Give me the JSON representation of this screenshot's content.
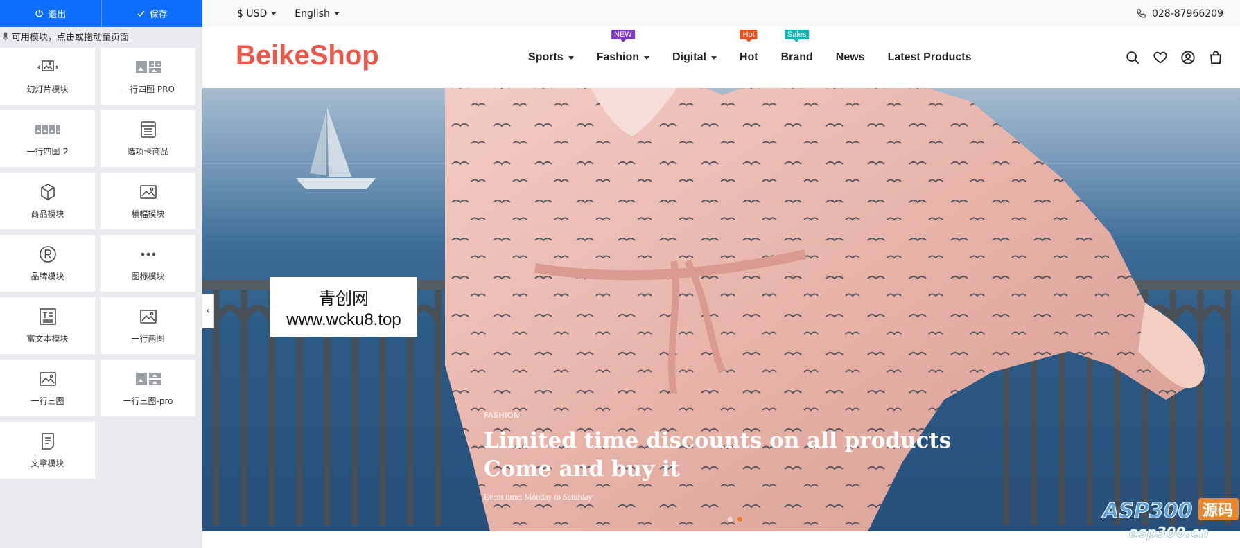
{
  "editor": {
    "exit_label": "退出",
    "save_label": "保存",
    "hint": "可用模块，点击或拖动至页面",
    "modules": [
      {
        "label": "幻灯片模块",
        "icon": "slideshow-icon"
      },
      {
        "label": "一行四图 PRO",
        "icon": "four-images-pro-icon"
      },
      {
        "label": "一行四图-2",
        "icon": "four-images-icon"
      },
      {
        "label": "选项卡商品",
        "icon": "tab-products-icon"
      },
      {
        "label": "商品模块",
        "icon": "product-box-icon"
      },
      {
        "label": "横幅模块",
        "icon": "banner-image-icon"
      },
      {
        "label": "品牌模块",
        "icon": "registered-brand-icon"
      },
      {
        "label": "图标模块",
        "icon": "ellipsis-icon"
      },
      {
        "label": "富文本模块",
        "icon": "rich-text-icon"
      },
      {
        "label": "一行两图",
        "icon": "two-images-icon"
      },
      {
        "label": "一行三图",
        "icon": "three-images-icon"
      },
      {
        "label": "一行三图-pro",
        "icon": "three-images-pro-icon"
      },
      {
        "label": "文章模块",
        "icon": "article-icon"
      }
    ],
    "collapse_glyph": "‹"
  },
  "store": {
    "currency": "$ USD",
    "language": "English",
    "phone": "028-87966209",
    "logo": "BeikeShop",
    "nav": [
      {
        "label": "Sports",
        "dropdown": true,
        "badge": null
      },
      {
        "label": "Fashion",
        "dropdown": true,
        "badge": {
          "text": "NEW",
          "color": "#7e3bbf"
        }
      },
      {
        "label": "Digital",
        "dropdown": true,
        "badge": null
      },
      {
        "label": "Hot",
        "dropdown": false,
        "badge": {
          "text": "Hot",
          "color": "#e8501f"
        }
      },
      {
        "label": "Brand",
        "dropdown": false,
        "badge": {
          "text": "Sales",
          "color": "#18b4b4"
        }
      },
      {
        "label": "News",
        "dropdown": false,
        "badge": null
      },
      {
        "label": "Latest Products",
        "dropdown": false,
        "badge": null
      }
    ],
    "header_icons": [
      "search-icon",
      "wishlist-heart-icon",
      "account-user-icon",
      "cart-bag-icon"
    ],
    "hero": {
      "kicker": "FASHION",
      "title_line1": "Limited time discounts on all products",
      "title_line2": "Come and buy it",
      "subtitle": "Event time: Monday to Saturday",
      "slides": 2,
      "active_slide": 2
    }
  },
  "overlay": {
    "watermark_line1": "青创网",
    "watermark_line2": "www.wcku8.top",
    "asp_brand": "ASP300",
    "asp_brand_cn": "源码",
    "asp_domain": "asp300.cn"
  },
  "colors": {
    "primary": "#0d6efd",
    "logo": "#e8584b",
    "accent": "#f07a2a"
  }
}
